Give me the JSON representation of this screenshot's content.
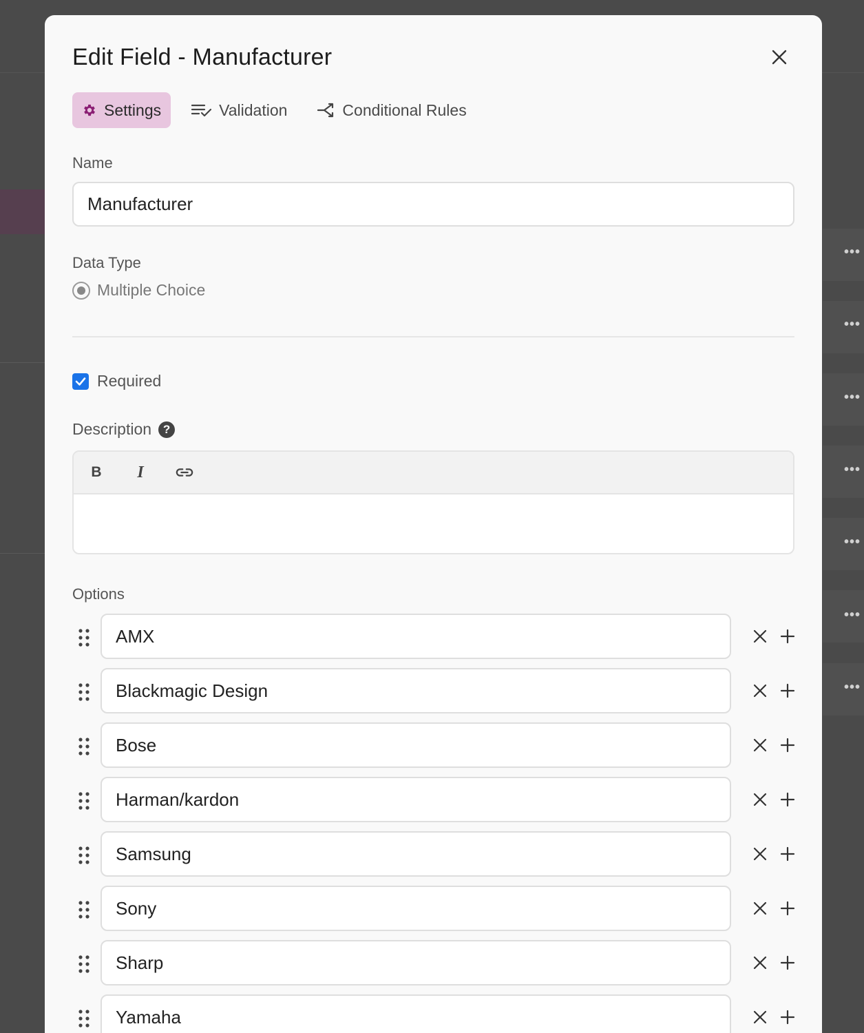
{
  "dialog": {
    "title": "Edit Field - Manufacturer",
    "close_icon": "close-icon"
  },
  "tabs": [
    {
      "label": "Settings",
      "icon": "gear-icon",
      "active": true
    },
    {
      "label": "Validation",
      "icon": "list-check-icon",
      "active": false
    },
    {
      "label": "Conditional Rules",
      "icon": "branch-icon",
      "active": false
    }
  ],
  "name": {
    "label": "Name",
    "value": "Manufacturer"
  },
  "data_type": {
    "label": "Data Type",
    "value": "Multiple Choice"
  },
  "required": {
    "label": "Required",
    "checked": true
  },
  "description": {
    "label": "Description",
    "help": "?",
    "toolbar": {
      "bold": "B",
      "italic": "I"
    }
  },
  "options": {
    "label": "Options",
    "items": [
      "AMX",
      "Blackmagic Design",
      "Bose",
      "Harman/kardon",
      "Samsung",
      "Sony",
      "Sharp",
      "Yamaha"
    ]
  },
  "colors": {
    "accent": "#1a73e8",
    "active_tab_bg": "#e8c6df",
    "gear": "#8a1e73"
  }
}
